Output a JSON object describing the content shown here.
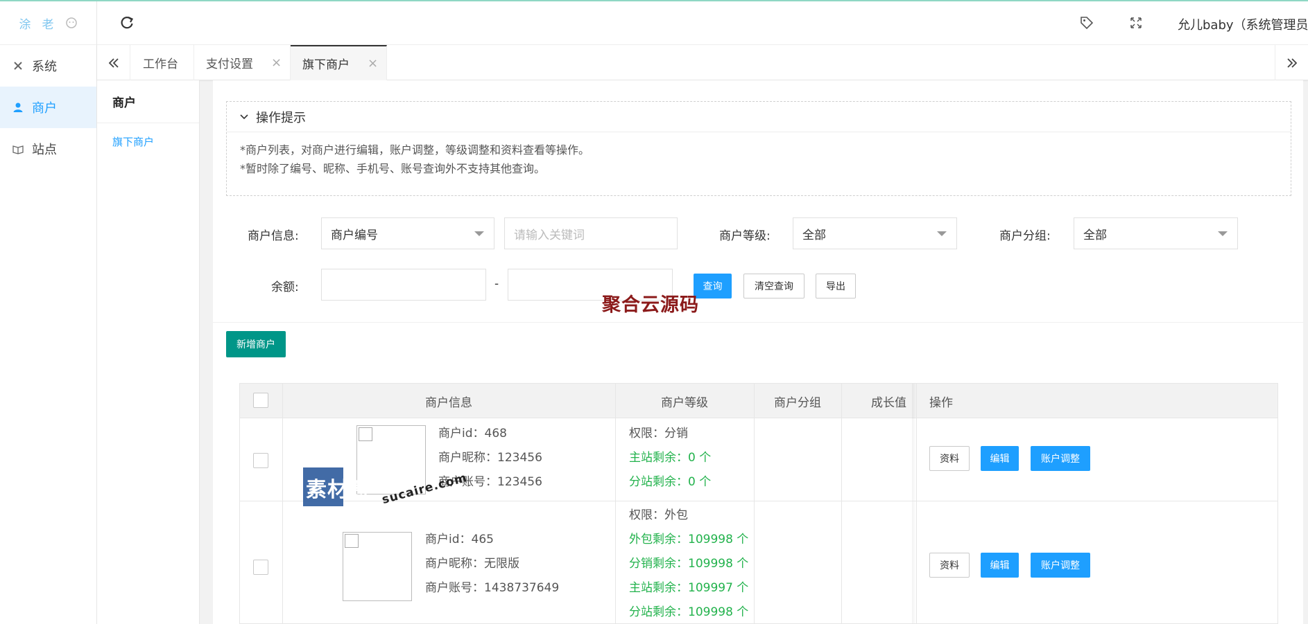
{
  "logo": {
    "chars": [
      "涂",
      "老"
    ]
  },
  "sidebar": {
    "items": [
      {
        "label": "系统",
        "icon": "tools-icon"
      },
      {
        "label": "商户",
        "icon": "user-icon"
      },
      {
        "label": "站点",
        "icon": "book-icon"
      }
    ]
  },
  "header": {
    "user": "允儿baby（系统管理员)"
  },
  "tabs": [
    {
      "label": "工作台"
    },
    {
      "label": "支付设置"
    },
    {
      "label": "旗下商户"
    }
  ],
  "tab_close": "×",
  "subnav": {
    "title": "商户",
    "item": "旗下商户"
  },
  "tips": {
    "title": "操作提示",
    "lines": [
      "*商户列表，对商户进行编辑，账户调整，等级调整和资料查看等操作。",
      "*暂时除了编号、昵称、手机号、账号查询外不支持其他查询。"
    ]
  },
  "filters": {
    "info_label": "商户信息:",
    "info_select": "商户编号",
    "keyword_placeholder": "请输入关键词",
    "level_label": "商户等级:",
    "level_select": "全部",
    "group_label": "商户分组:",
    "group_select": "全部",
    "balance_label": "余额:",
    "range_sep": "-"
  },
  "buttons": {
    "query": "查询",
    "clear": "清空查询",
    "export": "导出",
    "add": "新增商户"
  },
  "watermark": {
    "text1": "聚合云源码",
    "text2": "素材熟",
    "text3": "sucaire.com"
  },
  "table": {
    "headers": [
      "商户信息",
      "商户等级",
      "商户分组",
      "成长值",
      "操作"
    ],
    "rows": [
      {
        "id": "商户id：468",
        "nickname": "商户昵称：123456",
        "account": "商户账号：123456",
        "level": [
          "权限：分销",
          "主站剩余：0 个",
          "分站剩余：0 个"
        ]
      },
      {
        "id": "商户id：465",
        "nickname": "商户昵称：无限版",
        "account": "商户账号：1438737649",
        "level": [
          "权限：外包",
          "外包剩余：109998 个",
          "分销剩余：109998 个",
          "主站剩余：109997 个",
          "分站剩余：109998 个"
        ]
      }
    ],
    "actions": {
      "info": "资料",
      "edit": "编辑",
      "adjust": "账户调整"
    }
  }
}
